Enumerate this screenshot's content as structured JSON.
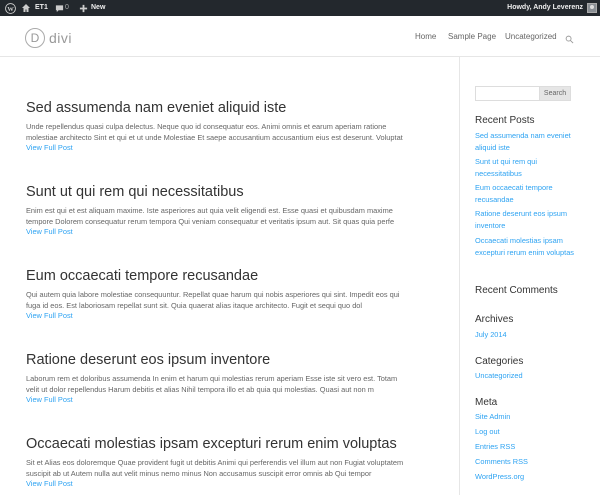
{
  "admin_bar": {
    "site_title": "ET1",
    "comments_count": "0",
    "new_label": "New",
    "howdy": "Howdy, Andy Leverenz"
  },
  "header": {
    "logo_mark": "D",
    "logo_text": "divi",
    "nav": [
      "Home",
      "Sample Page",
      "Uncategorized"
    ]
  },
  "posts": [
    {
      "title": "Sed assumenda nam eveniet aliquid iste",
      "excerpt_line1": "Unde repellendus quasi culpa delectus. Neque quo id consequatur eos. Animi omnis et earum aperiam ratione",
      "excerpt_line2": "molestiae architecto Sint et qui et ut unde Molestiae Et saepe accusantium accusantium eius est deserunt. Voluptat",
      "more": "View Full Post"
    },
    {
      "title": "Sunt ut qui rem qui necessitatibus",
      "excerpt_line1": "Enim est qui et est aliquam maxime. Iste asperiores aut quia velit eligendi est. Esse quasi et quibusdam maxime",
      "excerpt_line2": "tempore Dolorem consequatur rerum tempora Qui veniam consequatur et veritatis ipsum aut. Sit quas quia perfe",
      "more": "View Full Post"
    },
    {
      "title": "Eum occaecati tempore recusandae",
      "excerpt_line1": "Qui autem quia labore molestiae consequuntur. Repellat quae harum qui nobis asperiores qui sint. Impedit eos qui",
      "excerpt_line2": "fuga id eos. Est laboriosam repellat sunt sit. Quia quaerat alias itaque architecto. Fugit et sequi quo dol",
      "more": "View Full Post"
    },
    {
      "title": "Ratione deserunt eos ipsum inventore",
      "excerpt_line1": "Laborum rem et doloribus assumenda In enim et harum qui molestias rerum aperiam Esse iste sit vero est. Totam",
      "excerpt_line2": "velit ut dolor repellendus Harum debitis et alias Nihil tempora illo et ab quia qui molestias. Quasi aut non m",
      "more": "View Full Post"
    },
    {
      "title": "Occaecati molestias ipsam excepturi rerum enim voluptas",
      "excerpt_line1": "Sit et Alias eos doloremque Quae provident fugit ut debitis Animi qui perferendis vel illum aut non Fugiat voluptatem",
      "excerpt_line2": "suscipit ab ut Autem nulla aut velit minus nemo minus Non accusamus suscipit error omnis ab Qui tempor",
      "more": "View Full Post"
    }
  ],
  "sidebar": {
    "search_button": "Search",
    "recent_posts_title": "Recent Posts",
    "recent_posts": [
      "Sed assumenda nam eveniet aliquid iste",
      "Sunt ut qui rem qui necessitatibus",
      "Eum occaecati tempore recusandae",
      "Ratione deserunt eos ipsum inventore",
      "Occaecati molestias ipsam excepturi rerum enim voluptas"
    ],
    "recent_comments_title": "Recent Comments",
    "archives_title": "Archives",
    "archives": [
      "July 2014"
    ],
    "categories_title": "Categories",
    "categories": [
      "Uncategorized"
    ],
    "meta_title": "Meta",
    "meta": [
      "Site Admin",
      "Log out",
      "Entries RSS",
      "Comments RSS",
      "WordPress.org"
    ]
  },
  "colors": {
    "admin_bar_bg": "#23282d",
    "link": "#2ea3f2",
    "title": "#333333",
    "body_text": "#666666"
  }
}
